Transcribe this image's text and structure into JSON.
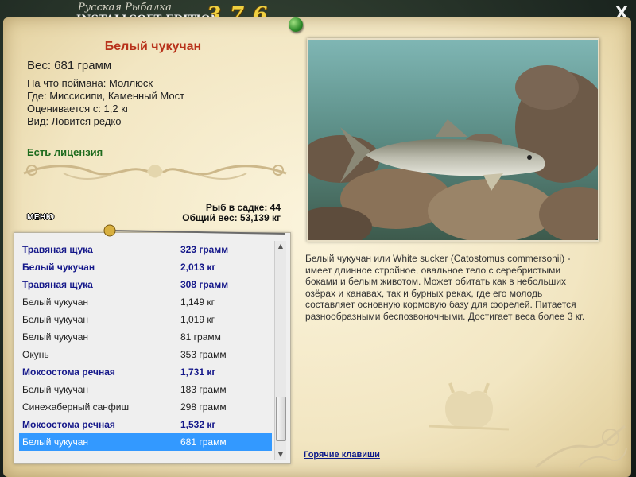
{
  "app": {
    "brand_top": "Русская Рыбалка",
    "brand_bottom": "INSTALLSOFT EDITION",
    "version": "3.7.6",
    "close_label": "X"
  },
  "fish": {
    "title": "Белый чукучан",
    "weight": "Вес: 681 грамм",
    "bait": "На что поймана: Моллюск",
    "location": "Где: Миссисипи, Каменный Мост",
    "rated_from": "Оценивается с: 1,2 кг",
    "kind": "Вид: Ловится редко",
    "license": "Есть лицензия"
  },
  "stats": {
    "count": "Рыб в садке: 44",
    "total_weight": "Общий вес: 53,139 кг"
  },
  "menu_label": "МЕНЮ",
  "catch_list": [
    {
      "name": "Травяная щука",
      "weight": "323 грамм",
      "highlight": true,
      "selected": false
    },
    {
      "name": "Белый чукучан",
      "weight": "2,013 кг",
      "highlight": true,
      "selected": false
    },
    {
      "name": "Травяная щука",
      "weight": "308 грамм",
      "highlight": true,
      "selected": false
    },
    {
      "name": "Белый чукучан",
      "weight": "1,149 кг",
      "highlight": false,
      "selected": false
    },
    {
      "name": "Белый чукучан",
      "weight": "1,019 кг",
      "highlight": false,
      "selected": false
    },
    {
      "name": "Белый чукучан",
      "weight": "81 грамм",
      "highlight": false,
      "selected": false
    },
    {
      "name": "Окунь",
      "weight": "353 грамм",
      "highlight": false,
      "selected": false
    },
    {
      "name": "Моксостома речная",
      "weight": "1,731 кг",
      "highlight": true,
      "selected": false
    },
    {
      "name": "Белый чукучан",
      "weight": "183 грамм",
      "highlight": false,
      "selected": false
    },
    {
      "name": "Синежаберный санфиш",
      "weight": "298 грамм",
      "highlight": false,
      "selected": false
    },
    {
      "name": "Моксостома речная",
      "weight": "1,532 кг",
      "highlight": true,
      "selected": false
    },
    {
      "name": "Белый чукучан",
      "weight": "681 грамм",
      "highlight": false,
      "selected": true
    }
  ],
  "description": "Белый чукучан или White sucker (Catostomus commersonii) - имеет длинное стройное, овальное тело с серебристыми боками и белым животом. Может обитать как в небольших озёрах и канавах, так и бурных реках, где его молодь составляет основную кормовую базу для форелей. Питается разнообразными беспозвоночными. Достигает веса более 3 кг.",
  "hotkeys_label": "Горячие клавиши",
  "icons": [
    "close-icon",
    "pin-icon",
    "scroll-up-icon",
    "scroll-down-icon",
    "fish-photo",
    "ornament-divider",
    "fisherman-stamp-icon",
    "corner-ornament-icon"
  ],
  "colors": {
    "title_red": "#b8321a",
    "license_green": "#1e6b1e",
    "list_highlight": "#15188a",
    "selection": "#3399ff",
    "link": "#0c1a8a",
    "version_gold": "#f0d040"
  }
}
